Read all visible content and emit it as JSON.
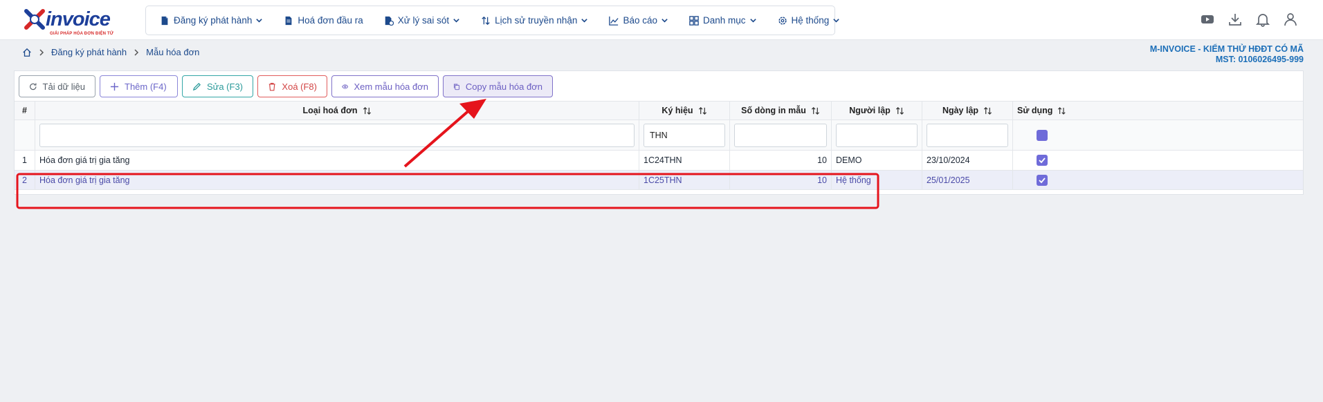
{
  "app": {
    "logo_text": "invoice",
    "logo_tagline": "GIẢI PHÁP HÓA ĐƠN ĐIỆN TỬ"
  },
  "nav": {
    "items": [
      {
        "label": "Đăng ký phát hành",
        "icon": "document-icon",
        "dropdown": true
      },
      {
        "label": "Hoá đơn đầu ra",
        "icon": "document-icon",
        "dropdown": false
      },
      {
        "label": "Xử lý sai sót",
        "icon": "document-edit-icon",
        "dropdown": true
      },
      {
        "label": "Lịch sử truyền nhận",
        "icon": "sort-arrows-icon",
        "dropdown": true
      },
      {
        "label": "Báo cáo",
        "icon": "chart-icon",
        "dropdown": true
      },
      {
        "label": "Danh mục",
        "icon": "grid-icon",
        "dropdown": true
      },
      {
        "label": "Hệ thống",
        "icon": "gear-icon",
        "dropdown": true
      }
    ],
    "right_icons": [
      "youtube-icon",
      "download-icon",
      "bell-icon",
      "user-icon"
    ]
  },
  "breadcrumb": {
    "items": [
      "Đăng ký phát hành",
      "Mẫu hóa đơn"
    ]
  },
  "company": {
    "name": "M-INVOICE - KIỂM THỬ HĐĐT CÓ MÃ",
    "tax_id": "MST: 0106026495-999"
  },
  "toolbar": {
    "reload": "Tải dữ liệu",
    "add": "Thêm (F4)",
    "edit": "Sửa (F3)",
    "delete": "Xoá (F8)",
    "view": "Xem mẫu hóa đơn",
    "copy": "Copy mẫu hóa đơn"
  },
  "table": {
    "headers": {
      "index": "#",
      "type": "Loại hoá đơn",
      "symbol": "Ký hiệu",
      "lines": "Số dòng in mẫu",
      "creator": "Người lập",
      "date": "Ngày lập",
      "in_use": "Sử dụng"
    },
    "filters": {
      "type": "",
      "symbol": "THN",
      "lines": "",
      "creator": "",
      "date": ""
    },
    "rows": [
      {
        "index": "1",
        "type": "Hóa đơn giá trị gia tăng",
        "symbol": "1C24THN",
        "lines": "10",
        "creator": "DEMO",
        "date": "23/10/2024",
        "in_use": true
      },
      {
        "index": "2",
        "type": "Hóa đơn giá trị gia tăng",
        "symbol": "1C25THN",
        "lines": "10",
        "creator": "Hệ thống",
        "date": "25/01/2025",
        "in_use": true
      }
    ]
  },
  "colors": {
    "accent": "#6f6bd9",
    "nav_text": "#1d4a8c",
    "annotation": "#e5141c"
  }
}
